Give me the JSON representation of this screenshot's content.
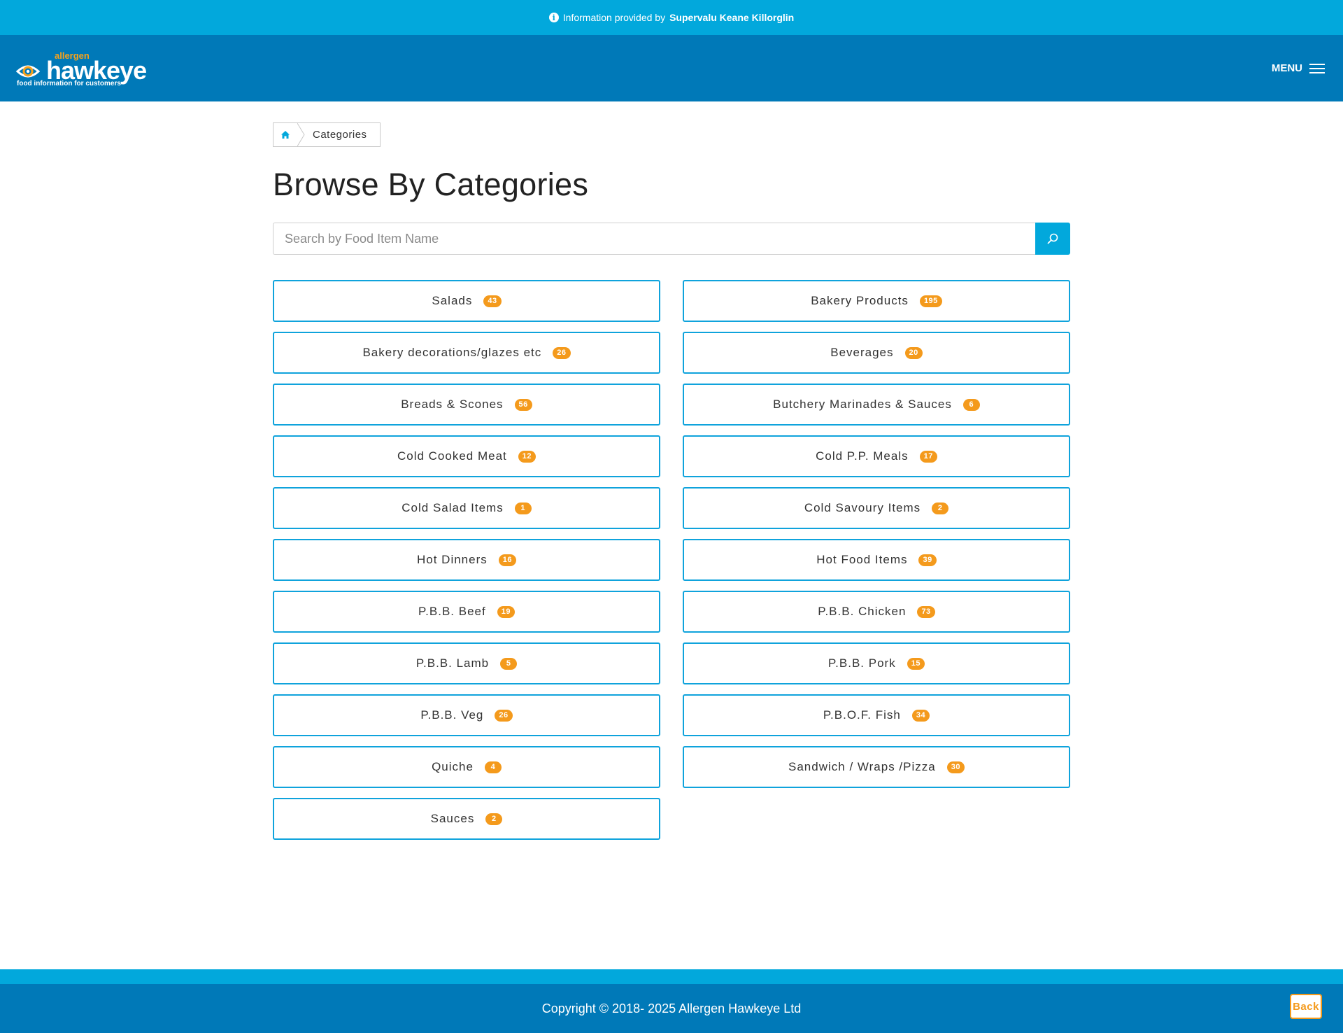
{
  "info_bar": {
    "prefix": "Information provided by",
    "provider": "Supervalu Keane Killorglin"
  },
  "header": {
    "logo": {
      "allergen": "allergen",
      "hawkeye": "hawkeye",
      "tagline": "food information for customers"
    },
    "menu_label": "MENU"
  },
  "breadcrumb": {
    "home_icon": "home-icon",
    "current": "Categories"
  },
  "page_title": "Browse By Categories",
  "search": {
    "placeholder": "Search by Food Item Name",
    "value": "",
    "button_icon": "search-icon"
  },
  "categories": [
    {
      "label": "Salads",
      "count": "43"
    },
    {
      "label": "Bakery Products",
      "count": "195"
    },
    {
      "label": "Bakery decorations/glazes etc",
      "count": "26"
    },
    {
      "label": "Beverages",
      "count": "20"
    },
    {
      "label": "Breads & Scones",
      "count": "56"
    },
    {
      "label": "Butchery Marinades & Sauces",
      "count": "6"
    },
    {
      "label": "Cold Cooked Meat",
      "count": "12"
    },
    {
      "label": "Cold P.P. Meals",
      "count": "17"
    },
    {
      "label": "Cold Salad Items",
      "count": "1"
    },
    {
      "label": "Cold Savoury Items",
      "count": "2"
    },
    {
      "label": "Hot Dinners",
      "count": "16"
    },
    {
      "label": "Hot Food Items",
      "count": "39"
    },
    {
      "label": "P.B.B. Beef",
      "count": "19"
    },
    {
      "label": "P.B.B. Chicken",
      "count": "73"
    },
    {
      "label": "P.B.B. Lamb",
      "count": "5"
    },
    {
      "label": "P.B.B. Pork",
      "count": "15"
    },
    {
      "label": "P.B.B. Veg",
      "count": "26"
    },
    {
      "label": "P.B.O.F. Fish",
      "count": "34"
    },
    {
      "label": "Quiche",
      "count": "4"
    },
    {
      "label": "Sandwich / Wraps /Pizza",
      "count": "30"
    },
    {
      "label": "Sauces",
      "count": "2"
    }
  ],
  "footer": {
    "copyright": "Copyright © 2018- 2025 Allergen Hawkeye Ltd",
    "back_label": "Back"
  },
  "colors": {
    "info_bar": "#02a8dc",
    "header": "#0079b8",
    "accent_border": "#0fa3dc",
    "badge": "#f49a1c"
  }
}
